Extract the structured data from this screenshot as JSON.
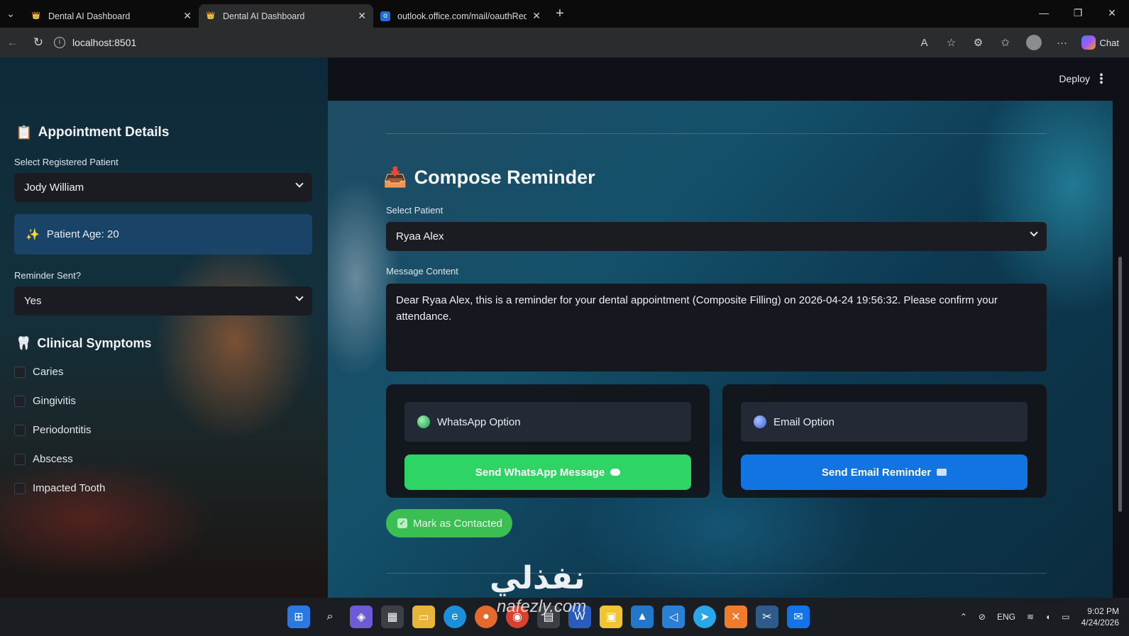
{
  "browser": {
    "tabs": [
      {
        "title": "Dental AI Dashboard"
      },
      {
        "title": "Dental AI Dashboard"
      },
      {
        "title": "outlook.office.com/mail/oauthRed"
      }
    ],
    "url": "localhost:8501",
    "chat_label": "Chat"
  },
  "app": {
    "deploy_label": "Deploy"
  },
  "sidebar": {
    "heading": "Appointment Details",
    "patient_label": "Select Registered Patient",
    "patient_value": "Jody William",
    "age_text": "Patient Age: 20",
    "reminder_label": "Reminder Sent?",
    "reminder_value": "Yes",
    "symptoms_heading": "Clinical Symptoms",
    "symptoms": [
      "Caries",
      "Gingivitis",
      "Periodontitis",
      "Abscess",
      "Impacted Tooth"
    ]
  },
  "main": {
    "title": "Compose Reminder",
    "select_patient_label": "Select Patient",
    "select_patient_value": "Ryaa Alex",
    "message_label": "Message Content",
    "message_text": "Dear Ryaa Alex, this is a reminder for your dental appointment (Composite Filling) on 2026-04-24 19:56:32. Please confirm your attendance.",
    "whatsapp_option": "WhatsApp Option",
    "email_option": "Email Option",
    "send_whatsapp": "Send WhatsApp Message",
    "send_email": "Send Email Reminder",
    "mark_contacted": "Mark as Contacted"
  },
  "taskbar": {
    "lang": "ENG",
    "time": "9:02 PM",
    "date": "4/24/2026"
  },
  "watermark": {
    "arabic": "نفذلي",
    "latin": "nafezly.com"
  },
  "colors": {
    "whatsapp_green": "#2fd564",
    "email_blue": "#1174e0",
    "contacted_green": "#3bbf53",
    "age_box": "#1c486e"
  }
}
